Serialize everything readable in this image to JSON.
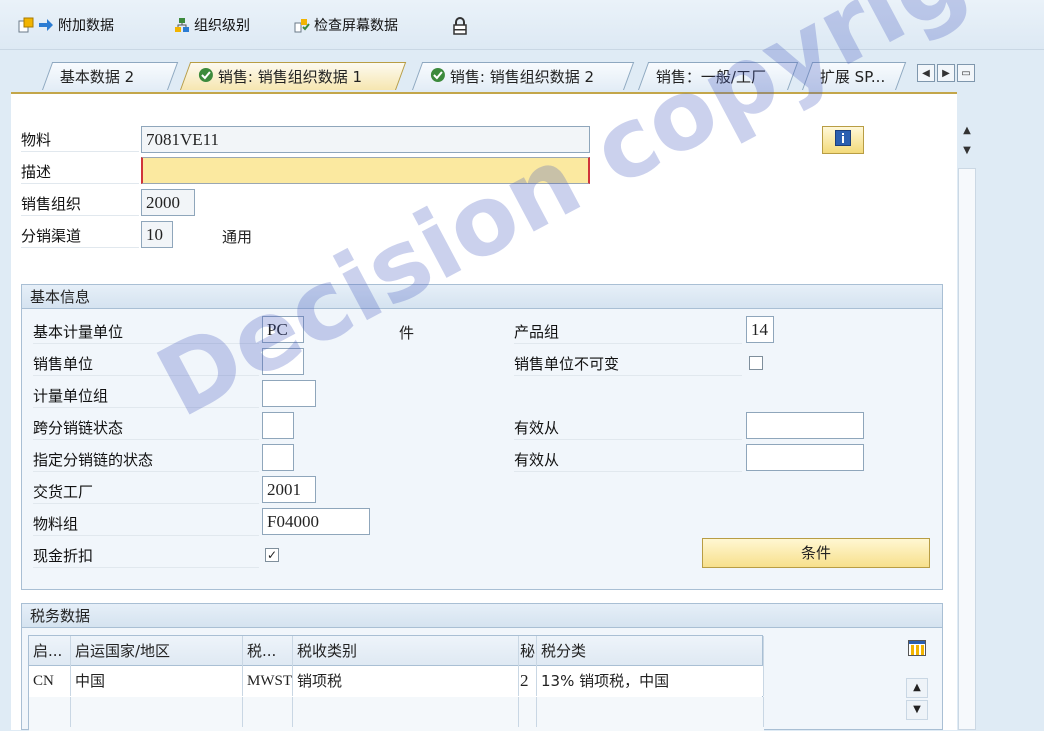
{
  "toolbar": {
    "items": [
      {
        "label": "附加数据",
        "icon": "additional-data-icon"
      },
      {
        "label": "组织级别",
        "icon": "org-levels-icon"
      },
      {
        "label": "检查屏幕数据",
        "icon": "check-screen-data-icon"
      },
      {
        "label": "",
        "icon": "lock-icon"
      }
    ]
  },
  "tabs": [
    {
      "label": "基本数据 2",
      "active": false,
      "checked": false
    },
    {
      "label": "销售: 销售组织数据 1",
      "active": true,
      "checked": true
    },
    {
      "label": "销售: 销售组织数据 2",
      "active": false,
      "checked": true
    },
    {
      "label": "销售：一般/工厂",
      "active": false,
      "checked": false
    },
    {
      "label": "扩展 SP...",
      "active": false,
      "checked": false
    }
  ],
  "header": {
    "material_label": "物料",
    "material_value": "7081VE11",
    "description_label": "描述",
    "description_value": "",
    "sales_org_label": "销售组织",
    "sales_org_value": "2000",
    "dist_channel_label": "分销渠道",
    "dist_channel_value": "10",
    "dist_channel_text": "通用"
  },
  "basic_info": {
    "title": "基本信息",
    "base_uom_label": "基本计量单位",
    "base_uom_value": "PC",
    "base_uom_text": "件",
    "product_group_label": "产品组",
    "product_group_value": "14",
    "sales_unit_label": "销售单位",
    "sales_unit_value": "",
    "sales_unit_fixed_label": "销售单位不可变",
    "uom_group_label": "计量单位组",
    "uom_group_value": "",
    "cross_status_label": "跨分销链状态",
    "cross_status_value": "",
    "valid_from_label": "有效从",
    "valid_from_value": "",
    "chain_status_label": "指定分销链的状态",
    "chain_status_value": "",
    "valid_from2_label": "有效从",
    "valid_from2_value": "",
    "plant_label": "交货工厂",
    "plant_value": "2001",
    "material_group_label": "物料组",
    "material_group_value": "F04000",
    "cash_discount_label": "现金折扣",
    "cash_discount_check": "✓",
    "conditions_button": "条件"
  },
  "tax": {
    "title": "税务数据",
    "columns": [
      "启...",
      "启运国家/地区",
      "税...",
      "税收类别",
      "秘",
      "税分类"
    ],
    "rows": [
      [
        "CN",
        "中国",
        "MWST",
        "销项税",
        "2",
        "13% 销项税，中国"
      ]
    ]
  },
  "watermark": "Decision copyright"
}
